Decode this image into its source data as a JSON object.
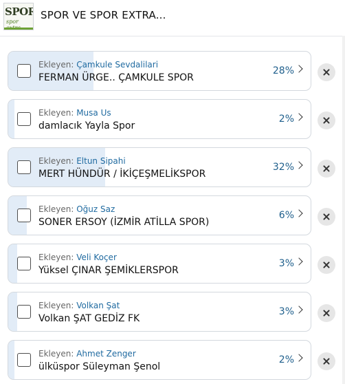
{
  "header": {
    "title": "SPOR VE SPOR EXTRA...",
    "logo_text": "SPOR",
    "logo_sub": "spor extra"
  },
  "added_by_label": "Ekleyen: ",
  "items": [
    {
      "user": "Çamkule Sevdalilari",
      "name": "FERMAN ÜRGE.. ÇAMKULE SPOR",
      "percent_label": "28%",
      "percent": 28
    },
    {
      "user": "Musa Us",
      "name": "damlacık Yayla Spor",
      "percent_label": "2%",
      "percent": 2
    },
    {
      "user": "Eltun Sipahi",
      "name": "MERT HÜNDÜR / İKİÇEŞMELİKSPOR",
      "percent_label": "32%",
      "percent": 32
    },
    {
      "user": "Oğuz Saz",
      "name": "SONER ERSOY (İZMİR ATİLLA SPOR)",
      "percent_label": "6%",
      "percent": 6
    },
    {
      "user": "Veli Koçer",
      "name": "Yüksel ÇINAR ŞEMİKLERSPOR",
      "percent_label": "3%",
      "percent": 3
    },
    {
      "user": "Volkan Şat",
      "name": "Volkan ŞAT GEDİZ FK",
      "percent_label": "3%",
      "percent": 3
    },
    {
      "user": "Ahmet Zenger",
      "name": "ülküspor Süleyman Şenol",
      "percent_label": "2%",
      "percent": 2
    }
  ]
}
